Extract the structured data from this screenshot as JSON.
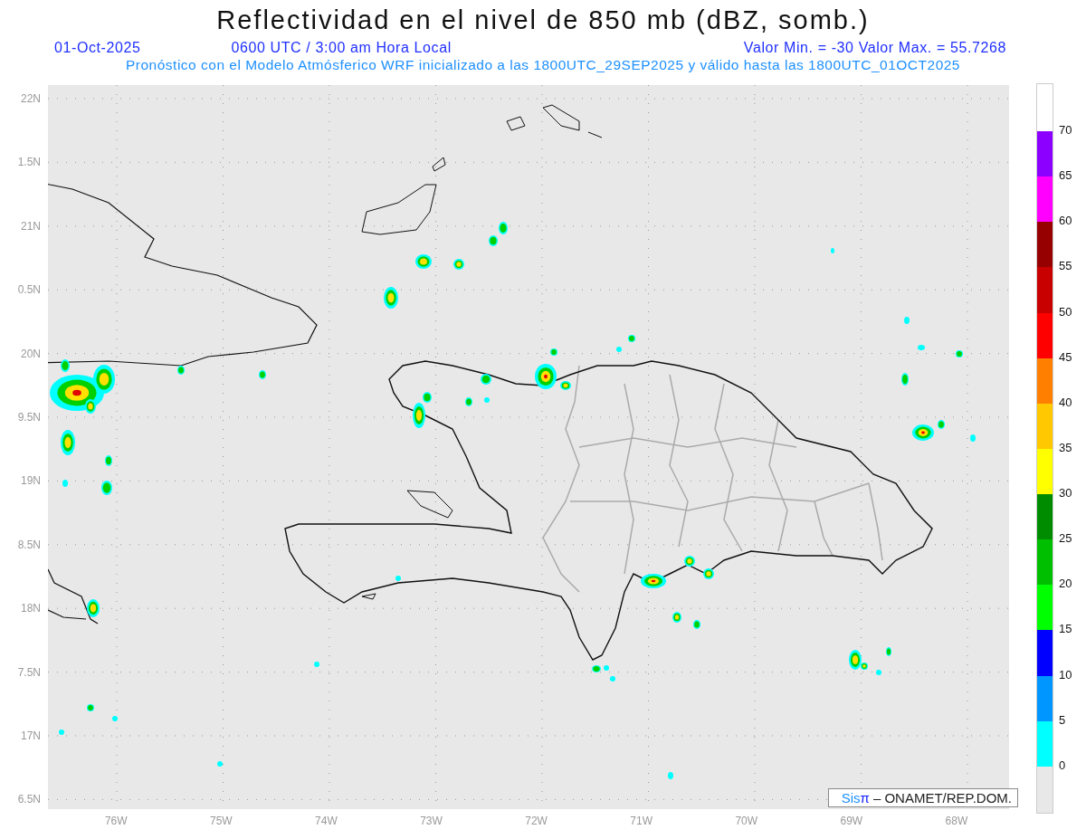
{
  "title": "Reflectividad en el nivel de 850 mb (dBZ, somb.)",
  "info": {
    "date": "01-Oct-2025",
    "time": "0600 UTC / 3:00 am Hora Local",
    "range": "Valor Min. = -30  Valor Max. = 55.7268"
  },
  "subtitle": "Pronóstico con el Modelo Atmósferico WRF inicializado a las 1800UTC_29SEP2025 y válido hasta las  1800UTC_01OCT2025",
  "lat_labels": [
    "22N",
    "1.5N",
    "21N",
    "0.5N",
    "20N",
    "9.5N",
    "19N",
    "8.5N",
    "18N",
    "7.5N",
    "17N",
    "6.5N"
  ],
  "lon_labels": [
    "76W",
    "75W",
    "74W",
    "73W",
    "72W",
    "71W",
    "70W",
    "69W",
    "68W"
  ],
  "colorbar": {
    "labels": [
      "70",
      "65",
      "60",
      "55",
      "50",
      "45",
      "40",
      "35",
      "30",
      "25",
      "20",
      "15",
      "10",
      "5",
      "0"
    ],
    "segments": [
      {
        "color": "#8c00ff"
      },
      {
        "color": "#ff00ff"
      },
      {
        "color": "#960000"
      },
      {
        "color": "#c80000"
      },
      {
        "color": "#ff0000"
      },
      {
        "color": "#ff7f00"
      },
      {
        "color": "#ffc800"
      },
      {
        "color": "#ffff00"
      },
      {
        "color": "#008c00"
      },
      {
        "color": "#00be00"
      },
      {
        "color": "#00ff00"
      },
      {
        "color": "#0000ff"
      },
      {
        "color": "#0096ff"
      },
      {
        "color": "#00ffff"
      }
    ]
  },
  "credit": {
    "brand": "Sis",
    "brand_mark": "π",
    "text": "– ONAMET/REP.DOM."
  }
}
